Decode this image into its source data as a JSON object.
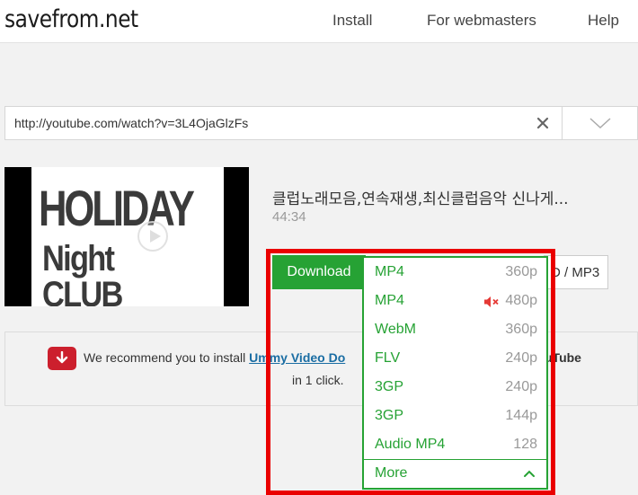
{
  "header": {
    "logo": "savefrom.net",
    "nav": [
      "Install",
      "For webmasters",
      "Help"
    ]
  },
  "search": {
    "url": "http://youtube.com/watch?v=3L4OjaGlzFs",
    "clear_icon": "close-icon",
    "dropdown_icon": "chevron-down-icon"
  },
  "video": {
    "thumbnail_line1": "HOLIDAY",
    "thumbnail_line2": "Night CLUB",
    "title": "클럽노래모음,연속재생,최신클럽음악 신나게...",
    "duration": "44:34"
  },
  "actions": {
    "download_label": "Download",
    "mp3_label": "D / MP3"
  },
  "formats": [
    {
      "format": "MP4",
      "quality": "360p",
      "muted": false
    },
    {
      "format": "MP4",
      "quality": "480p",
      "muted": true
    },
    {
      "format": "WebM",
      "quality": "360p",
      "muted": false
    },
    {
      "format": "FLV",
      "quality": "240p",
      "muted": false
    },
    {
      "format": "3GP",
      "quality": "240p",
      "muted": false
    },
    {
      "format": "3GP",
      "quality": "144p",
      "muted": false
    },
    {
      "format": "Audio MP4",
      "quality": "128",
      "muted": false
    }
  ],
  "more_label": "More",
  "recommend": {
    "prefix": "We recommend you to install ",
    "link": "Ummy Video Do",
    "suffix": "uTube",
    "line2": "in 1 click."
  },
  "colors": {
    "accent_green": "#26a234",
    "highlight_red": "#ea0000",
    "link_blue": "#1a6da3",
    "mute_red": "#e53935"
  }
}
